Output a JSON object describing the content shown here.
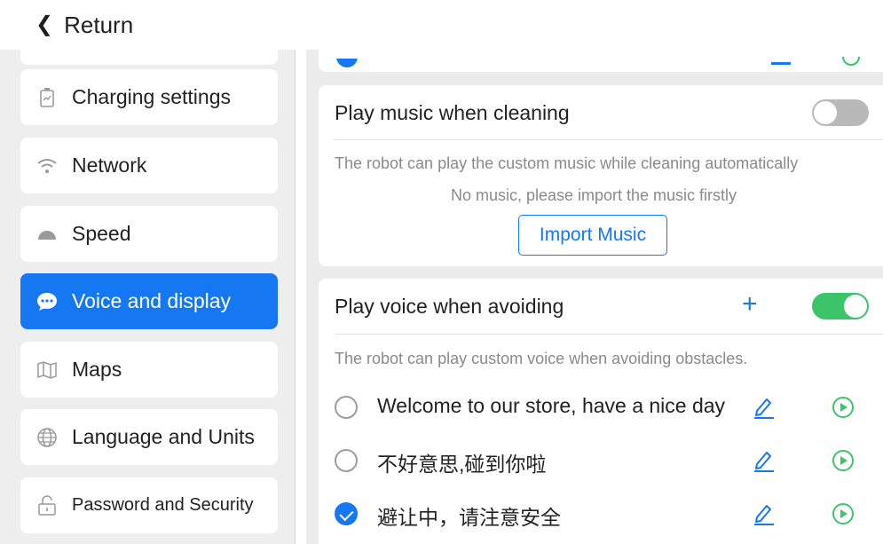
{
  "header": {
    "back_label": "Return"
  },
  "sidebar": {
    "items": [
      {
        "label": "Charging settings",
        "icon": "battery-icon"
      },
      {
        "label": "Network",
        "icon": "wifi-icon"
      },
      {
        "label": "Speed",
        "icon": "speed-icon"
      },
      {
        "label": "Voice and display",
        "icon": "chat-bubble-icon",
        "active": true
      },
      {
        "label": "Maps",
        "icon": "map-icon"
      },
      {
        "label": "Language and Units",
        "icon": "globe-icon"
      },
      {
        "label": "Password and Security",
        "icon": "lock-icon"
      }
    ]
  },
  "main": {
    "music": {
      "title": "Play music when cleaning",
      "enabled": false,
      "description": "The robot can play the custom music while cleaning automatically",
      "empty_text": "No music, please import the music firstly",
      "import_label": "Import Music"
    },
    "voice": {
      "title": "Play voice when avoiding",
      "enabled": true,
      "description": "The robot can play custom voice when avoiding obstacles.",
      "items": [
        {
          "text": "Welcome to our store, have a nice day",
          "checked": false
        },
        {
          "text": "不好意思,碰到你啦",
          "checked": false
        },
        {
          "text": "避让中，请注意安全",
          "checked": true
        }
      ]
    }
  },
  "colors": {
    "accent": "#1677f3",
    "toggle_on": "#3cc46a",
    "toggle_off": "#b9b9b9"
  }
}
